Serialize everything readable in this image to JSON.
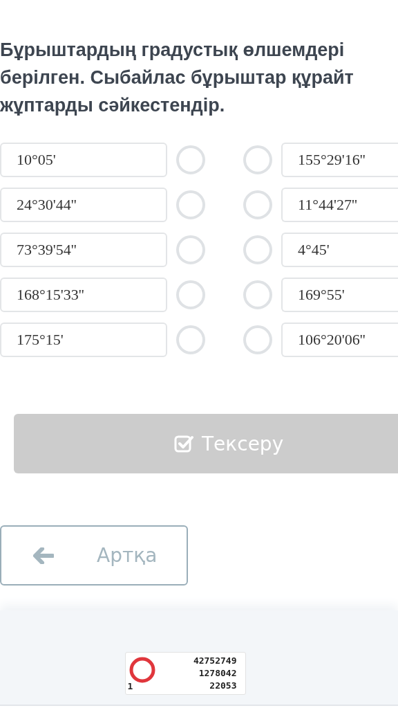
{
  "question": "Бұрыштардың градустық өлшемдері\nберілген. Сыбайлас бұрыштар құрайт\nжұптарды сәйкестендір.",
  "left_items": [
    {
      "text": "10°05'",
      "selected": false
    },
    {
      "text": "24°30'44''",
      "selected": false
    },
    {
      "text": "73°39'54''",
      "selected": false
    },
    {
      "text": "168°15'33''",
      "selected": false
    },
    {
      "text": "175°15'",
      "selected": false
    }
  ],
  "right_items": [
    {
      "text": "155°29'16''",
      "selected": false
    },
    {
      "text": "11°44'27''",
      "selected": false
    },
    {
      "text": "4°45'",
      "selected": false
    },
    {
      "text": "169°55'",
      "selected": false
    },
    {
      "text": "106°20'06''",
      "selected": false
    }
  ],
  "check_button": {
    "label": "Тексеру",
    "disabled": true
  },
  "back_button": {
    "label": "Артқа"
  },
  "counter": {
    "index": "1",
    "lines": [
      "42752749",
      "1278042",
      "22053"
    ]
  }
}
